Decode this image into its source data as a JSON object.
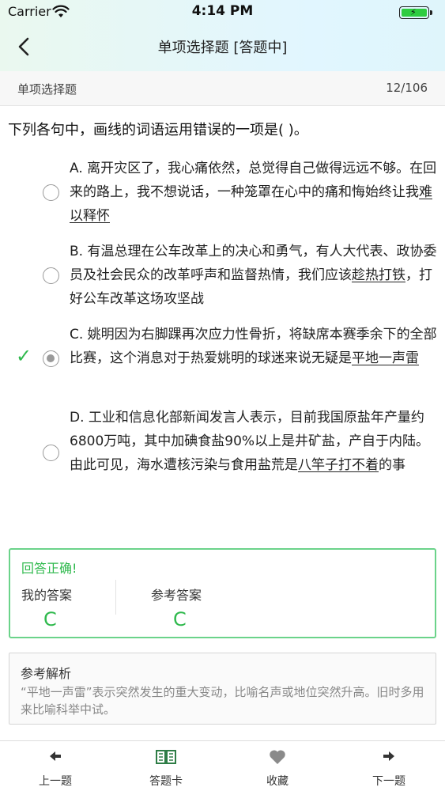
{
  "status_bar": {
    "carrier": "Carrier",
    "time": "4:14 PM"
  },
  "nav": {
    "title": "单项选择题 [答题中]"
  },
  "subheader": {
    "type": "单项选择题",
    "progress": "12/106"
  },
  "question": {
    "text": "下列各句中，画线的词语运用错误的一项是(  )。"
  },
  "options": [
    {
      "pre": "A. 离开灾区了，我心痛依然，总觉得自己做得远远不够。在回来的路上，我不想说话，一种笼罩在心中的痛和悔始终让我",
      "underlined": "难以释怀",
      "post": "",
      "selected": false,
      "correct": false
    },
    {
      "pre": "B. 有温总理在公车改革上的决心和勇气，有人大代表、政协委员及社会民众的改革呼声和监督热情，我们应该",
      "underlined": "趁热打铁",
      "post": "，打好公车改革这场攻坚战",
      "selected": false,
      "correct": false
    },
    {
      "pre": "C. 姚明因为右脚踝再次应力性骨折，将缺席本赛季余下的全部比赛，这个消息对于热爱姚明的球迷来说无疑是",
      "underlined": "平地一声雷",
      "post": "",
      "selected": true,
      "correct": true
    },
    {
      "pre": "D. 工业和信息化部新闻发言人表示，目前我国原盐年产量约6800万吨，其中加碘食盐90%以上是井矿盐，产自于内陆。由此可见，海水遭核污染与食用盐荒是",
      "underlined": "八竿子打不着",
      "post": "的事",
      "selected": false,
      "correct": false
    }
  ],
  "check_mark": "✓",
  "answer": {
    "result": "回答正确!",
    "my_label": "我的答案",
    "my_value": "C",
    "ref_label": "参考答案",
    "ref_value": "C"
  },
  "analysis": {
    "title": "参考解析",
    "body": "“平地一声雷”表示突然发生的重大变动，比喻名声或地位突然升高。旧时多用来比喻科举中试。"
  },
  "tabs": [
    {
      "label": "上一题",
      "icon": "arrow-left-icon"
    },
    {
      "label": "答题卡",
      "icon": "book-icon"
    },
    {
      "label": "收藏",
      "icon": "heart-icon"
    },
    {
      "label": "下一题",
      "icon": "arrow-right-icon"
    }
  ],
  "colors": {
    "accent": "#2fb94d",
    "border_green": "#6bd38a",
    "battery": "#2ecc40"
  }
}
